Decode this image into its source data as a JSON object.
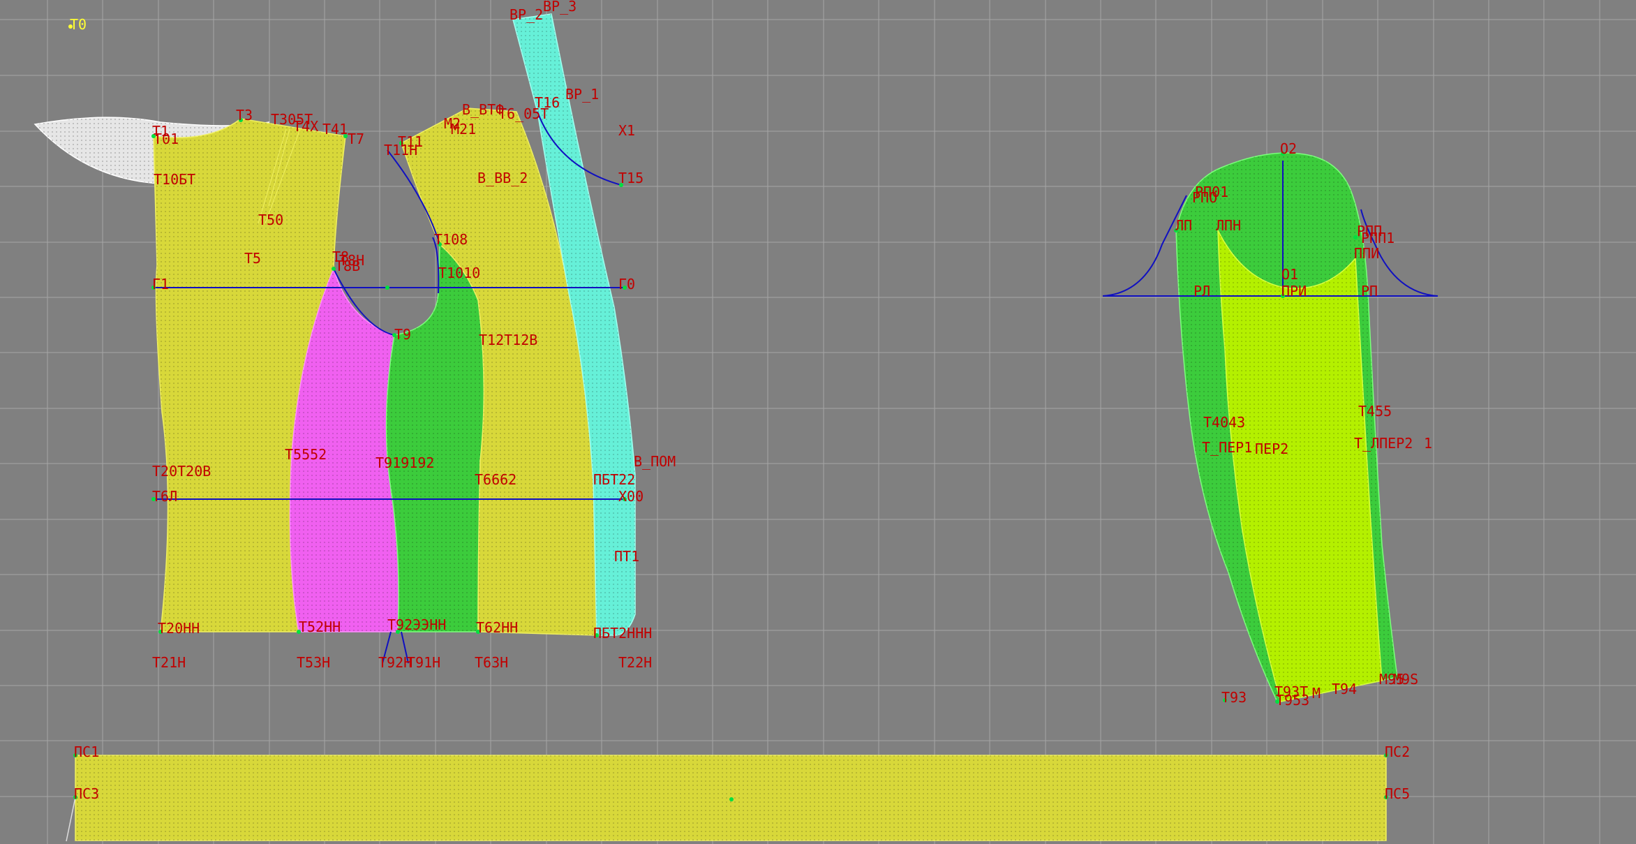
{
  "colors": {
    "background": "#808080",
    "grid": "#a6a6a6",
    "label": "#c00000",
    "origin_label": "#ffff33",
    "construction_line": "#1010c0",
    "point": "#00e040",
    "yellow_fill": "#d8d83a",
    "magenta_fill": "#f060f0",
    "green_fill": "#3ccc3c",
    "cyan_fill": "#66f0d8",
    "lime_fill": "#b4f000",
    "white_piece": "#e6e6e6"
  },
  "origin_label": "T0",
  "labels": {
    "t1": "T1",
    "t01": "T01",
    "t3": "T3",
    "t305t": "T305T",
    "t4x": "T4Х",
    "t41": "T41",
    "t7": "T7",
    "t10bt": "T10БТ",
    "t50": "T50",
    "t5": "T5",
    "t8": "T8",
    "t8h": "T8Н",
    "t8b": "T8В",
    "g1": "Г1",
    "t20b": "T20T20В",
    "t6l": "T6Л",
    "t20hh": "T20НН",
    "t2h": "T21Н",
    "t555": "T5552",
    "t52hh": "T52НН",
    "t53h": "T53Н",
    "t9": "T9",
    "t919": "T919192",
    "t92hh": "T92ЭЭНН",
    "t92h": "T92Н",
    "t91h": "T91Н",
    "t11": "T11",
    "t11h": "T11Н",
    "t108": "T108",
    "t1010": "T1010",
    "t12": "T12T12В",
    "t662": "T6662",
    "t62hh": "T62НН",
    "t63h": "T63Н",
    "m2": "M2",
    "m21": "M21",
    "b": "В_ВТФ",
    "b2": "В_ВВ_2",
    "t16": "T16",
    "t6bt": "T6_05Т",
    "vr1": "ВР_1",
    "vr2": "ВР_2",
    "vr3": "ВР_3",
    "x1": "X1",
    "t15": "T15",
    "g0": "Г0",
    "b_pom": "В_ПОМ",
    "pbt": "ПБТ22",
    "x00": "X00",
    "pt1": "ПТ1",
    "pbh": "ПБТ2ННН",
    "t22h": "T22Н",
    "o2": "O2",
    "rpo": "РПО",
    "rp01": "РП01",
    "lp": "ЛП",
    "lph": "ЛПН",
    "rpp": "РПП",
    "rpp1": "РПП1",
    "ppi": "ППИ",
    "o1": "O1",
    "rl": "РЛ",
    "pr": "ПРИ",
    "rp": "РП",
    "t4043": "T4043",
    "t_per1": "T_ПЕР1",
    "per2": "ПЕР2",
    "t455": "T455",
    "t_lper": "T_ЛПЕР2",
    "p1": "1",
    "t93": "T93",
    "t93b": "T93Т",
    "t95": "T953",
    "m": "М",
    "t94": "T94",
    "m95": "M95",
    "ms": "M9S",
    "ps1": "ПС1",
    "ps2": "ПС2",
    "ps3": "ПС3",
    "ps5": "ПС5"
  }
}
